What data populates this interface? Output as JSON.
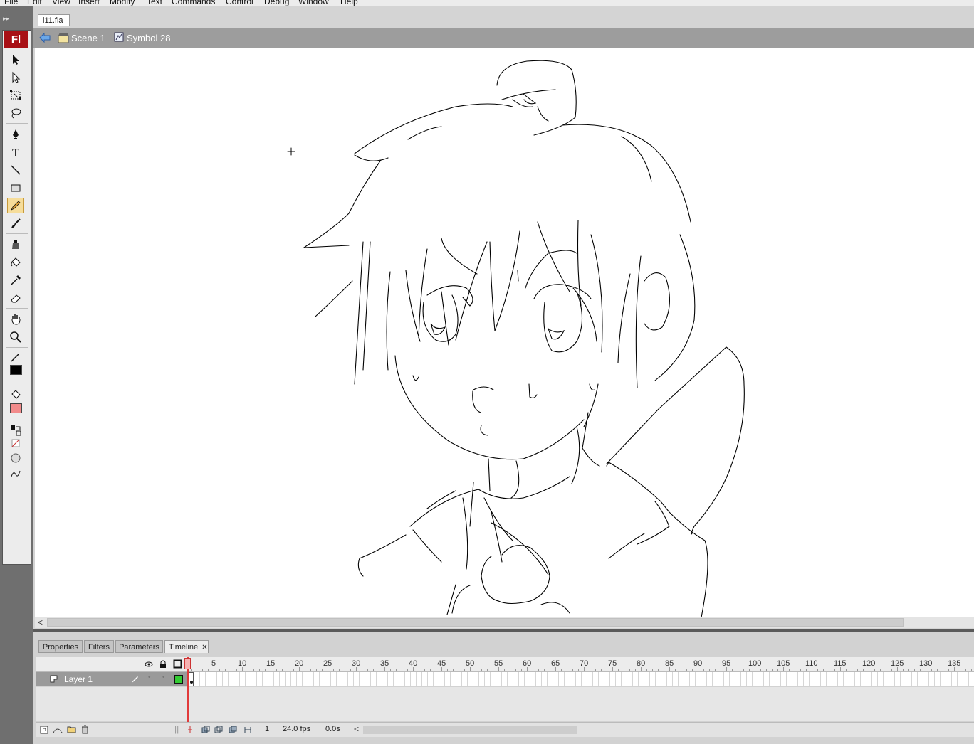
{
  "menu": [
    "File",
    "Edit",
    "View",
    "Insert",
    "Modify",
    "Text",
    "Commands",
    "Control",
    "Debug",
    "Window",
    "Help"
  ],
  "app": {
    "logo_text": "Fl"
  },
  "toolbox": {
    "tools": [
      {
        "name": "selection-tool-icon"
      },
      {
        "name": "subselection-tool-icon"
      },
      {
        "name": "free-transform-tool-icon"
      },
      {
        "name": "lasso-tool-icon"
      },
      {
        "name": "pen-tool-icon"
      },
      {
        "name": "text-tool-icon",
        "glyph": "T"
      },
      {
        "name": "line-tool-icon"
      },
      {
        "name": "rectangle-tool-icon"
      },
      {
        "name": "pencil-tool-icon",
        "active": true
      },
      {
        "name": "brush-tool-icon"
      },
      {
        "name": "ink-bottle-tool-icon"
      },
      {
        "name": "paint-bucket-tool-icon"
      },
      {
        "name": "eyedropper-tool-icon"
      },
      {
        "name": "eraser-tool-icon"
      },
      {
        "name": "hand-tool-icon"
      },
      {
        "name": "zoom-tool-icon"
      }
    ],
    "stroke_color": "#000000",
    "fill_color": "#f28b8b"
  },
  "document": {
    "tab": "l11.fla",
    "breadcrumb": {
      "scene": "Scene 1",
      "symbol": "Symbol 28"
    }
  },
  "panels": {
    "tabs": [
      "Properties",
      "Filters",
      "Parameters",
      "Timeline"
    ],
    "active_tab": "Timeline",
    "timeline": {
      "frame_numbers": [
        "5",
        "10",
        "15",
        "20",
        "25",
        "30",
        "35",
        "40",
        "45",
        "50",
        "55",
        "60",
        "65",
        "70",
        "75",
        "80",
        "85",
        "90",
        "95",
        "100",
        "105",
        "110",
        "115",
        "120",
        "125",
        "130",
        "135"
      ],
      "layer": {
        "name": "Layer 1",
        "outline_color": "#33cc33"
      },
      "current_frame": "1",
      "fps": "24.0 fps",
      "elapsed": "0.0s"
    }
  }
}
